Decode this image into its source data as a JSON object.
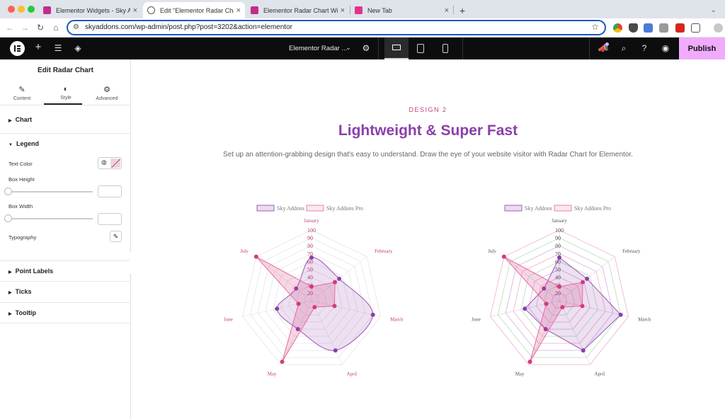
{
  "browser": {
    "tabs": [
      {
        "title": "Elementor Widgets - Sky Addons"
      },
      {
        "title": "Edit \"Elementor Radar Chart\""
      },
      {
        "title": "Elementor Radar Chart Widget"
      },
      {
        "title": "New Tab"
      }
    ],
    "new_tab_symbol": "+",
    "close_symbol": "×",
    "url": "skyaddons.com/wp-admin/post.php?post=3202&action=elementor"
  },
  "editor_bar": {
    "document_title": "Elementor Radar ...",
    "publish_label": "Publish"
  },
  "panel": {
    "title": "Edit Radar Chart",
    "tabs": [
      {
        "label": "Content",
        "icon": "pencil-icon"
      },
      {
        "label": "Style",
        "icon": "contrast-icon"
      },
      {
        "label": "Advanced",
        "icon": "gear-icon"
      }
    ],
    "sections": {
      "chart": "Chart",
      "legend": "Legend",
      "point_labels": "Point Labels",
      "ticks": "Ticks",
      "tooltip": "Tooltip"
    },
    "controls": {
      "text_color": "Text Color",
      "box_height": "Box Height",
      "box_width": "Box Width",
      "typography": "Typography"
    }
  },
  "page": {
    "eyebrow": "DESIGN 2",
    "heading": "Lightweight & Super Fast",
    "description": "Set up an attention-grabbing design that's easy to understand. Draw the eye of your website visitor with Radar Chart for Elementor."
  },
  "colors": {
    "accent": "#8b3fa8",
    "pink": "#d6397a",
    "publish_bg": "#f0abfc"
  },
  "chart_data": [
    {
      "type": "radar",
      "labels": [
        "January",
        "February",
        "March",
        "April",
        "May",
        "June",
        "July"
      ],
      "ticks": [
        20,
        30,
        40,
        50,
        60,
        70,
        80,
        90,
        100
      ],
      "ylim": [
        10,
        100
      ],
      "legend_position": "top",
      "series": [
        {
          "name": "Sky Addons",
          "values": [
            65,
            55,
            90,
            80,
            50,
            55,
            35
          ]
        },
        {
          "name": "Sky Addons Pro",
          "values": [
            28,
            48,
            40,
            19,
            96,
            27,
            100
          ]
        }
      ]
    },
    {
      "type": "radar",
      "labels": [
        "January",
        "February",
        "March",
        "April",
        "May",
        "June",
        "July"
      ],
      "ticks": [
        20,
        30,
        40,
        50,
        60,
        70,
        80,
        90,
        100
      ],
      "ylim": [
        10,
        100
      ],
      "legend_position": "top",
      "series": [
        {
          "name": "Sky Addons",
          "values": [
            65,
            55,
            90,
            80,
            50,
            55,
            35
          ]
        },
        {
          "name": "Sky Addons Pro",
          "values": [
            28,
            48,
            40,
            19,
            96,
            27,
            100
          ]
        }
      ]
    }
  ]
}
